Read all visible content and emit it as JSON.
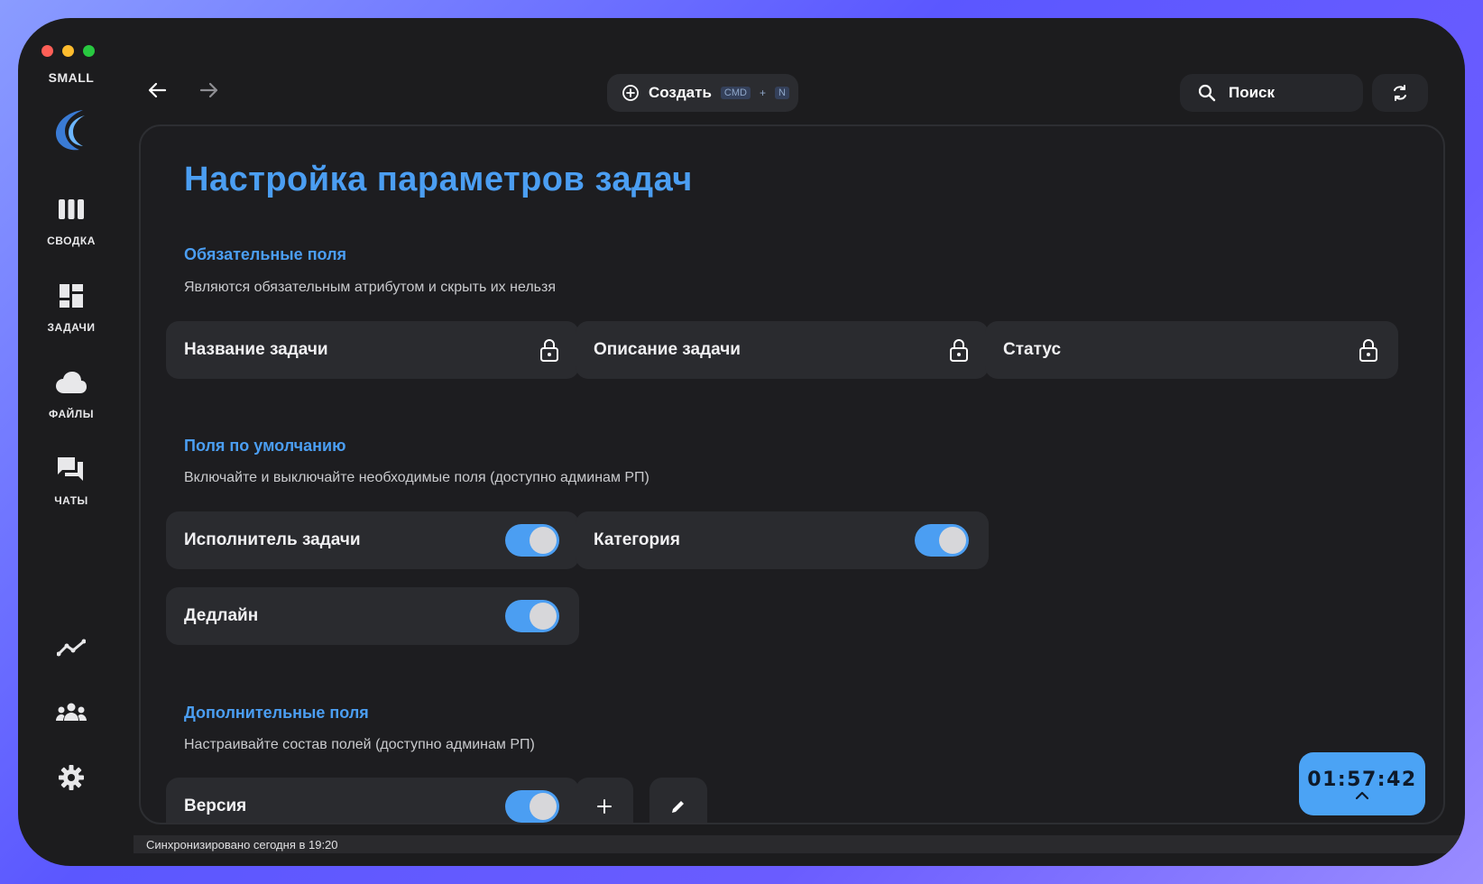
{
  "app": {
    "brand": "SMALL",
    "accent": "#4b9ef2"
  },
  "sidebar": {
    "items": [
      {
        "icon": "summary-icon",
        "label": "СВОДКА"
      },
      {
        "icon": "tasks-icon",
        "label": "ЗАДАЧИ"
      },
      {
        "icon": "cloud-icon",
        "label": "ФАЙЛЫ"
      },
      {
        "icon": "chat-icon",
        "label": "ЧАТЫ"
      }
    ],
    "bottom_icons": [
      "analytics-icon",
      "team-icon",
      "settings-icon"
    ]
  },
  "topbar": {
    "create_label": "Создать",
    "shortcut_key1": "CMD",
    "shortcut_plus": "+",
    "shortcut_key2": "N",
    "search_label": "Поиск"
  },
  "page": {
    "title": "Настройка параметров задач"
  },
  "required": {
    "title": "Обязательные поля",
    "description": "Являются обязательным атрибутом и скрыть их нельзя",
    "fields": [
      "Название задачи",
      "Описание задачи",
      "Статус"
    ]
  },
  "defaults": {
    "title": "Поля по умолчанию",
    "description": "Включайте и выключайте необходимые поля (доступно админам РП)",
    "fields": [
      {
        "label": "Исполнитель задачи",
        "enabled": true
      },
      {
        "label": "Категория",
        "enabled": true
      },
      {
        "label": "Дедлайн",
        "enabled": true
      }
    ]
  },
  "extra": {
    "title": "Дополнительные поля",
    "description": "Настраивайте состав полей (доступно админам РП)",
    "fields": [
      {
        "label": "Версия",
        "enabled": true
      }
    ]
  },
  "timer": {
    "value": "01:57:42"
  },
  "status": {
    "text": "Синхронизировано сегодня в 19:20"
  }
}
